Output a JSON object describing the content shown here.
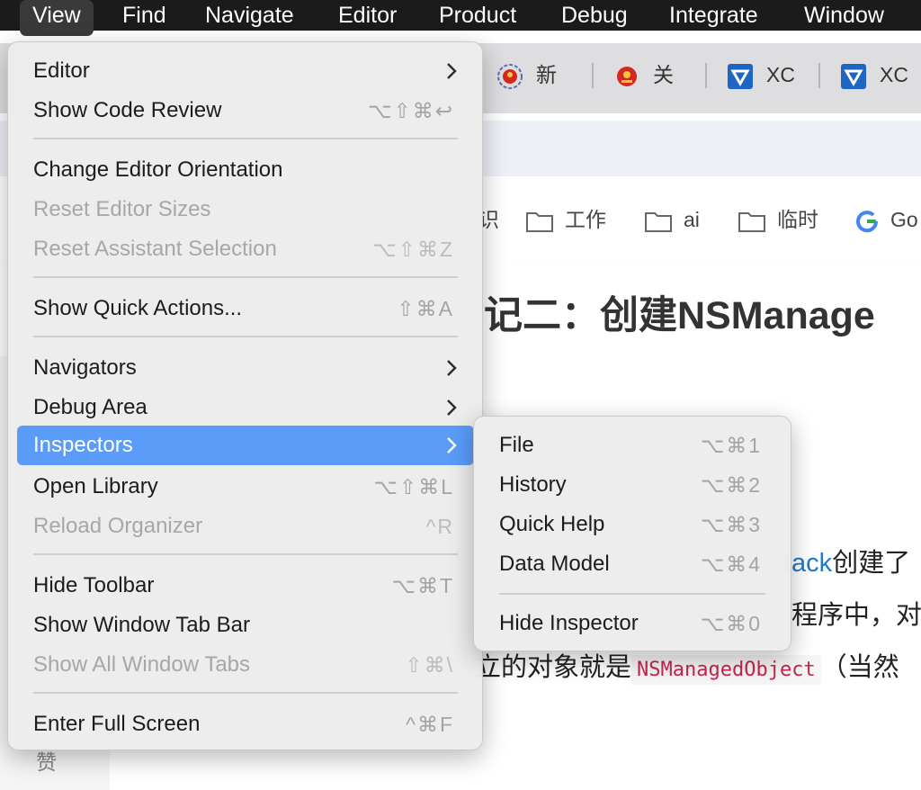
{
  "menubar": {
    "items": [
      "View",
      "Find",
      "Navigate",
      "Editor",
      "Product",
      "Debug",
      "Integrate",
      "Window"
    ]
  },
  "browser": {
    "tabs": [
      "新",
      "关",
      "XC",
      "XC"
    ],
    "bookmarks": [
      "工作",
      "ai",
      "临时",
      "Go"
    ],
    "bookmark_partial": "识"
  },
  "article": {
    "title": "记二：创建NSManage",
    "line1_link": "tack",
    "line1_rest": "创建了",
    "line2": "程序中，对",
    "line3_pre": "立的对象就是",
    "line3_code": "NSManagedObject",
    "line3_post": "（当然",
    "reward": "赞"
  },
  "view_menu": {
    "items": [
      {
        "label": "Editor",
        "shortcut": "",
        "submenu": true,
        "disabled": false
      },
      {
        "label": "Show Code Review",
        "shortcut": "⌥⇧⌘↩",
        "submenu": false,
        "disabled": false
      },
      {
        "label": "Change Editor Orientation",
        "shortcut": "",
        "submenu": false,
        "disabled": false
      },
      {
        "label": "Reset Editor Sizes",
        "shortcut": "",
        "submenu": false,
        "disabled": true
      },
      {
        "label": "Reset Assistant Selection",
        "shortcut": "⌥⇧⌘Z",
        "submenu": false,
        "disabled": true
      },
      {
        "label": "Show Quick Actions...",
        "shortcut": "⇧⌘A",
        "submenu": false,
        "disabled": false
      },
      {
        "label": "Navigators",
        "shortcut": "",
        "submenu": true,
        "disabled": false
      },
      {
        "label": "Debug Area",
        "shortcut": "",
        "submenu": true,
        "disabled": false
      },
      {
        "label": "Inspectors",
        "shortcut": "",
        "submenu": true,
        "disabled": false,
        "highlighted": true
      },
      {
        "label": "Open Library",
        "shortcut": "⌥⇧⌘L",
        "submenu": false,
        "disabled": false
      },
      {
        "label": "Reload Organizer",
        "shortcut": "^R",
        "submenu": false,
        "disabled": true
      },
      {
        "label": "Hide Toolbar",
        "shortcut": "⌥⌘T",
        "submenu": false,
        "disabled": false
      },
      {
        "label": "Show Window Tab Bar",
        "shortcut": "",
        "submenu": false,
        "disabled": false
      },
      {
        "label": "Show All Window Tabs",
        "shortcut": "⇧⌘\\",
        "submenu": false,
        "disabled": true
      },
      {
        "label": "Enter Full Screen",
        "shortcut": "^⌘F",
        "submenu": false,
        "disabled": false
      }
    ]
  },
  "inspectors_menu": {
    "items": [
      {
        "label": "File",
        "shortcut": "⌥⌘1"
      },
      {
        "label": "History",
        "shortcut": "⌥⌘2"
      },
      {
        "label": "Quick Help",
        "shortcut": "⌥⌘3"
      },
      {
        "label": "Data Model",
        "shortcut": "⌥⌘4"
      },
      {
        "label": "Hide Inspector",
        "shortcut": "⌥⌘0"
      }
    ]
  },
  "colors": {
    "menubar_bg": "#1b1b1b",
    "menu_bg": "#ececec",
    "highlight": "#5a9cf8",
    "disabled_text": "#a7a7a7",
    "shortcut_text": "#a4a4a4",
    "link": "#1f7ac7",
    "code_text": "#c7254e"
  },
  "icons": {
    "submenu": "chevron-right-icon",
    "bookmark": "folder-icon",
    "tab_emblem": "emblem-icon",
    "tab_xcode": "xc-logo-icon",
    "google": "google-g-icon"
  }
}
